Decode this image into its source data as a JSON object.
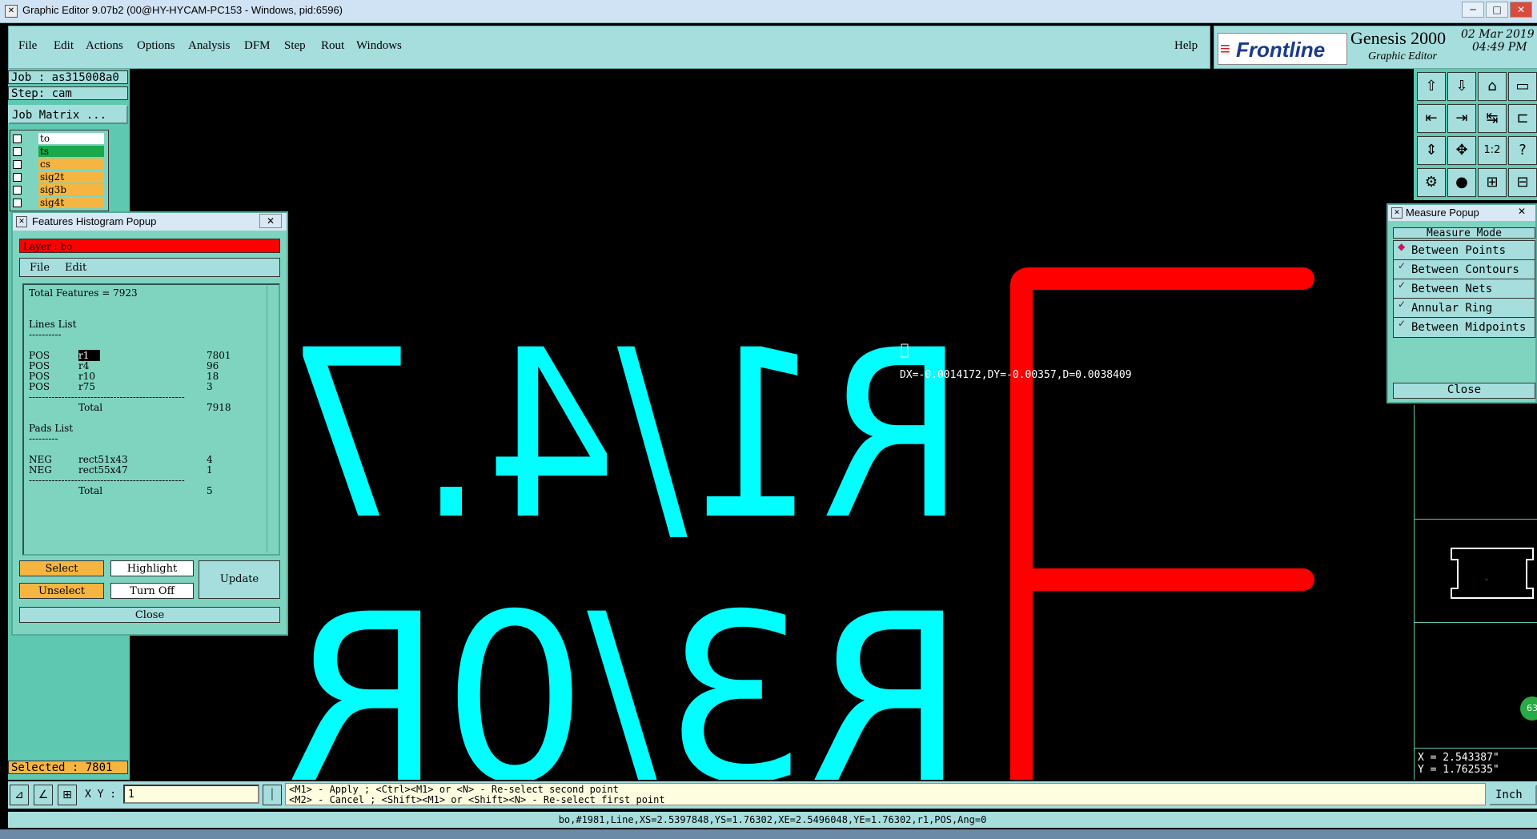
{
  "window": {
    "title": "Graphic Editor 9.07b2 (00@HY-HYCAM-PC153 - Windows, pid:6596)",
    "controls": [
      "─",
      "□",
      "✕"
    ]
  },
  "menu": {
    "items": [
      "File",
      "Edit",
      "Actions",
      "Options",
      "Analysis",
      "DFM",
      "Step",
      "Rout",
      "Windows"
    ],
    "help": "Help"
  },
  "brand": {
    "logo": "Frontline",
    "product": "Genesis 2000",
    "subtitle": "Graphic Editor",
    "date": "02 Mar 2019",
    "time": "04:49 PM"
  },
  "left": {
    "job": "Job : as315008a0",
    "step": "Step: cam",
    "job_matrix": "Job Matrix ...",
    "layers": [
      {
        "name": "to",
        "color": "#ffffff"
      },
      {
        "name": "ts",
        "color": "#1aa84a"
      },
      {
        "name": "cs",
        "color": "#f5b540"
      },
      {
        "name": "sig2t",
        "color": "#f5b540"
      },
      {
        "name": "sig3b",
        "color": "#f5b540"
      },
      {
        "name": "sig4t",
        "color": "#f5b540"
      }
    ],
    "selected": "Selected : 7801"
  },
  "histogram": {
    "title": "Features Histogram Popup",
    "layer": "Layer :  bo",
    "menu": [
      "File",
      "Edit"
    ],
    "total_features": "Total Features = 7923",
    "lines_title": "Lines List",
    "lines": [
      {
        "pol": "POS",
        "sym": "r1",
        "count": "7801"
      },
      {
        "pol": "POS",
        "sym": "r4",
        "count": "96"
      },
      {
        "pol": "POS",
        "sym": "r10",
        "count": "18"
      },
      {
        "pol": "POS",
        "sym": "r75",
        "count": "3"
      }
    ],
    "lines_total": "7918",
    "pads_title": "Pads List",
    "pads": [
      {
        "pol": "NEG",
        "sym": "rect51x43",
        "count": "4"
      },
      {
        "pol": "NEG",
        "sym": "rect55x47",
        "count": "1"
      }
    ],
    "pads_total": "5",
    "total_label": "Total",
    "buttons": {
      "select": "Select",
      "highlight": "Highlight",
      "unselect": "Unselect",
      "turn_off": "Turn Off",
      "update": "Update",
      "close": "Close"
    }
  },
  "canvas": {
    "text_top": "R1/4.7",
    "text_bottom": "R3/0R",
    "measure_readout": "DX=-0.0014172,DY=-0.00357,D=0.0038409",
    "text_color": "#00ffff",
    "outline_color": "#ff0000"
  },
  "measure": {
    "title": "Measure Popup",
    "mode_label": "Measure Mode",
    "options": [
      "Between Points",
      "Between Contours",
      "Between Nets",
      "Annular Ring",
      "Between Midpoints"
    ],
    "selected_index": 0,
    "close": "Close"
  },
  "coords": {
    "x": "X = 2.543387\"",
    "y": "Y = 1.762535\"",
    "badge": "63"
  },
  "command": {
    "xy_label": "X Y :",
    "xy_value": "1",
    "hint1": "<M1> - Apply  ; <Ctrl><M1> or <N> - Re-select second point",
    "hint2": "<M2> - Cancel ; <Shift><M1> or <Shift><N> - Re-select first point",
    "units": "Inch"
  },
  "status": "bo,#1981,Line,XS=2.5397848,YS=1.76302,XE=2.5496048,YE=1.76302,r1,POS,Ang=0"
}
